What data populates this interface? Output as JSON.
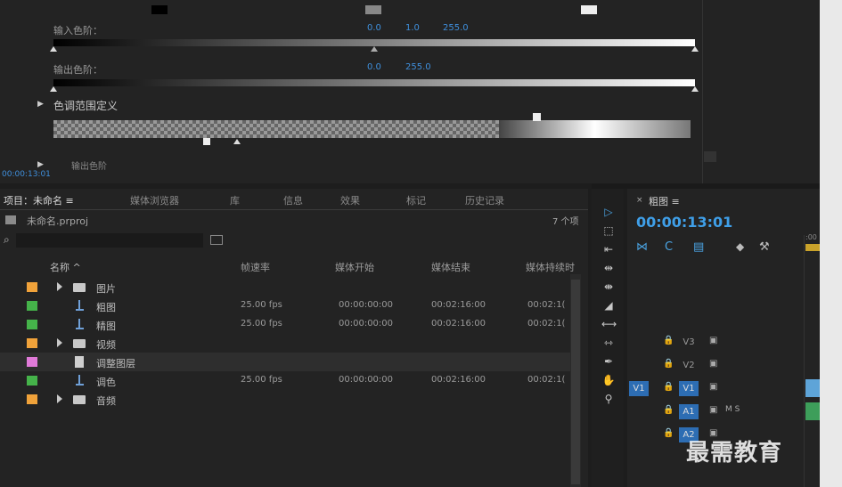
{
  "effect_controls": {
    "input_levels_label": "输入色阶：",
    "input_levels_values": [
      "0.0",
      "1.0",
      "255.0"
    ],
    "output_levels_label": "输出色阶：",
    "output_levels_values": [
      "0.0",
      "255.0"
    ],
    "tone_range_label": "色调范围定义",
    "partial_row_label": "输出色阶",
    "timecode": "00:00:13:01"
  },
  "project_panel": {
    "tabs": [
      "项目：未命名 ≡",
      "媒体浏览器",
      "库",
      "信息",
      "效果",
      "标记",
      "历史记录"
    ],
    "project_file": "未命名.prproj",
    "item_count": "7 个项",
    "search_placeholder": "",
    "columns": [
      "名称 ^",
      "帧速率",
      "媒体开始",
      "媒体结束",
      "媒体持续时"
    ],
    "rows": [
      {
        "name": "图片",
        "kind": "folder",
        "color": "#f0a23a",
        "fps": "",
        "start": "",
        "end": "",
        "dur": ""
      },
      {
        "name": "粗图",
        "kind": "sequence",
        "color": "#45b34a",
        "fps": "25.00 fps",
        "start": "00:00:00:00",
        "end": "00:02:16:00",
        "dur": "00:02:1("
      },
      {
        "name": "精图",
        "kind": "sequence",
        "color": "#45b34a",
        "fps": "25.00 fps",
        "start": "00:00:00:00",
        "end": "00:02:16:00",
        "dur": "00:02:1("
      },
      {
        "name": "视频",
        "kind": "folder",
        "color": "#f0a23a",
        "fps": "",
        "start": "",
        "end": "",
        "dur": ""
      },
      {
        "name": "调整图层",
        "kind": "file",
        "color": "#e07ad8",
        "fps": "",
        "start": "",
        "end": "",
        "dur": ""
      },
      {
        "name": "调色",
        "kind": "sequence",
        "color": "#45b34a",
        "fps": "25.00 fps",
        "start": "00:00:00:00",
        "end": "00:02:16:00",
        "dur": "00:02:1("
      },
      {
        "name": "音频",
        "kind": "folder",
        "color": "#f0a23a",
        "fps": "",
        "start": "",
        "end": "",
        "dur": ""
      }
    ]
  },
  "tools": [
    "selection-tool-icon",
    "track-select-icon",
    "ripple-edit-icon",
    "rolling-edit-icon",
    "rate-stretch-icon",
    "razor-icon",
    "slip-icon",
    "slide-icon",
    "pen-icon",
    "hand-icon",
    "zoom-icon"
  ],
  "timeline": {
    "title": "粗图 ≡",
    "timecode": "00:00:13:01",
    "ruler_label": ":00",
    "tracks": [
      {
        "id": "V3",
        "src": "",
        "active": false
      },
      {
        "id": "V2",
        "src": "",
        "active": false
      },
      {
        "id": "V1",
        "src": "V1",
        "active": true
      },
      {
        "id": "A1",
        "src": "",
        "active": true,
        "extra": "M  S"
      },
      {
        "id": "A2",
        "src": "",
        "active": true
      }
    ]
  },
  "watermark": "最需教育"
}
